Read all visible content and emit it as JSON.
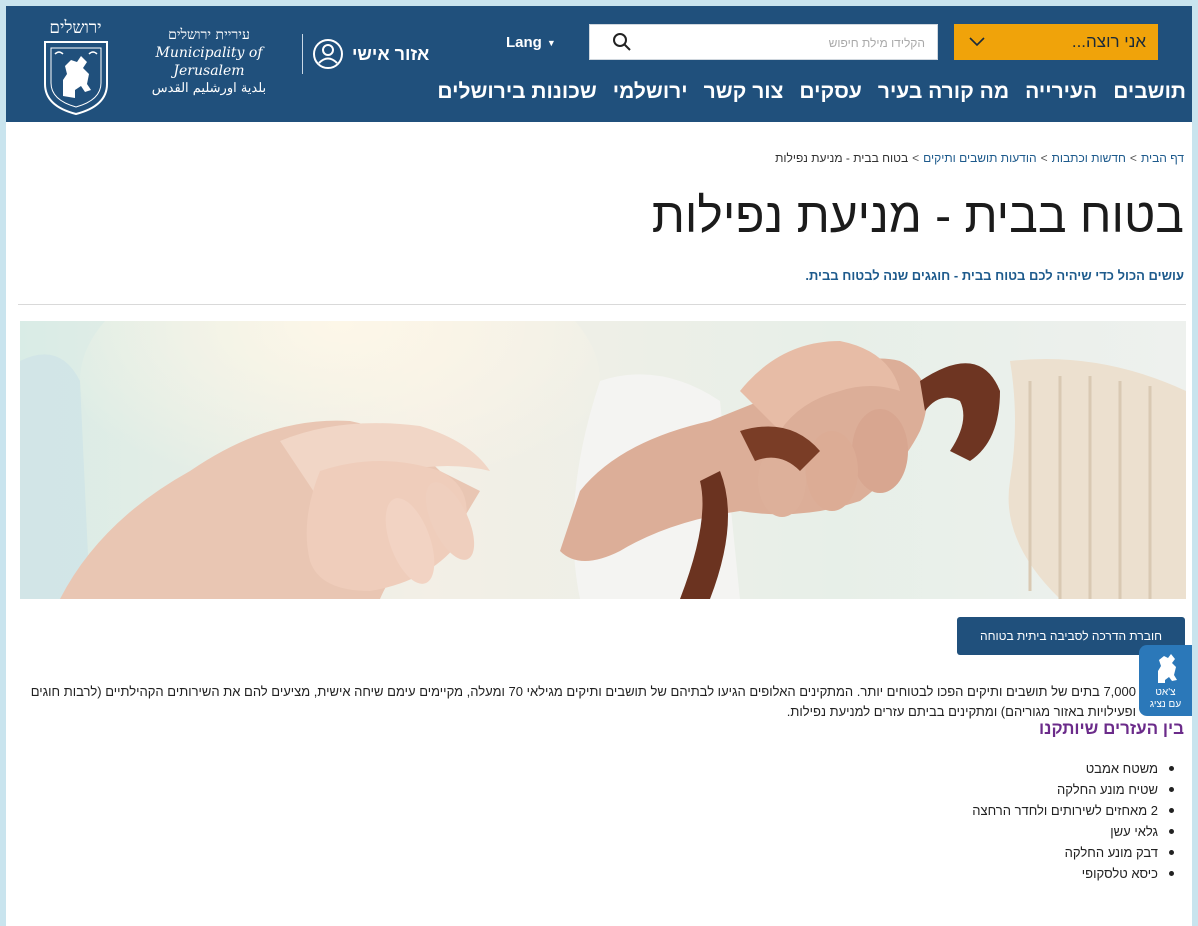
{
  "header": {
    "crest_title": "ירושלים",
    "municipality_he": "עיריית ירושלים",
    "municipality_en": "Municipality of Jerusalem",
    "municipality_ar": "بلدية اورشليم القدس",
    "personal_area": "אזור אישי",
    "lang": "Lang",
    "search_placeholder": "הקלידו מילת חיפוש",
    "i_want": "אני רוצה...",
    "nav": [
      "תושבים",
      "העירייה",
      "מה קורה בעיר",
      "עסקים",
      "צור קשר",
      "ירושלמי",
      "שכונות בירושלים"
    ]
  },
  "breadcrumb": [
    "דף הבית",
    "חדשות וכתבות",
    "הודעות תושבים ותיקים",
    "בטוח בבית - מניעת נפילות"
  ],
  "page": {
    "title": "בטוח בבית - מניעת נפילות",
    "subtitle": "עושים הכול כדי שיהיה לכם בטוח בבית - חוגגים שנה לבטוח בבית.",
    "guide_button": "חוברת הדרכה לסביבה ביתית בטוחה",
    "paragraph": "7,000 בתים של תושבים ותיקים הפכו לבטוחים יותר. המתקינים האלופים הגיעו לבתיהם של תושבים ותיקים מגילאי 70 ומעלה, מקיימים עימם שיחה אישית, מציעים להם את השירותים הקהילתיים (לרבות חוגים ופעילויות באזור מגוריהם) ומתקינים בביתם עזרים למניעת נפילות.",
    "section_title": "בין העזרים שיותקנו",
    "items": [
      "משטח אמבט",
      "שטיח מונע החלקה",
      "2 מאחזים לשירותים ולחדר הרחצה",
      "גלאי עשן",
      "דבק מונע החלקה",
      "כיסא טלסקופי"
    ]
  },
  "chat": {
    "line1": "צ'אט",
    "line2": "עם נציג"
  },
  "colors": {
    "header": "#20507c",
    "accent": "#f0a30a",
    "section": "#6b2b8a",
    "chat": "#2b78b9"
  }
}
